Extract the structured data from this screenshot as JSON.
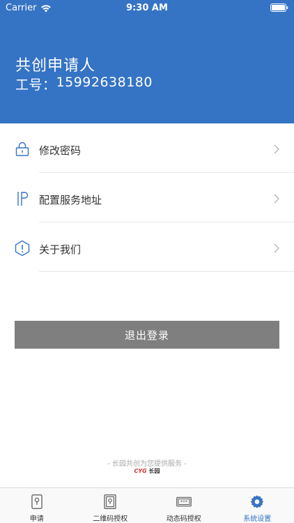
{
  "status_bar": {
    "carrier": "Carrier",
    "time": "9:30 AM"
  },
  "user": {
    "name": "共创申请人",
    "id_label": "工号：",
    "id_value": "15992638180"
  },
  "menu": {
    "items": [
      {
        "label": "修改密码",
        "icon": "lock-icon"
      },
      {
        "label": "配置服务地址",
        "icon": "ip-icon"
      },
      {
        "label": "关于我们",
        "icon": "info-hexagon-icon"
      }
    ]
  },
  "logout_label": "退出登录",
  "footer": {
    "note": "- 长园共创为您提供服务 -",
    "brand": "CYG",
    "brand_cn": "长园"
  },
  "tabbar": {
    "tabs": [
      {
        "label": "申请",
        "icon": "key-icon"
      },
      {
        "label": "二维码授权",
        "icon": "qr-key-icon"
      },
      {
        "label": "动态码授权",
        "icon": "password-icon"
      },
      {
        "label": "系统设置",
        "icon": "gear-icon",
        "active": true
      }
    ]
  },
  "colors": {
    "accent": "#3573c4",
    "logout_button": "#7f7f7f",
    "brand_red": "#d32f2f"
  }
}
